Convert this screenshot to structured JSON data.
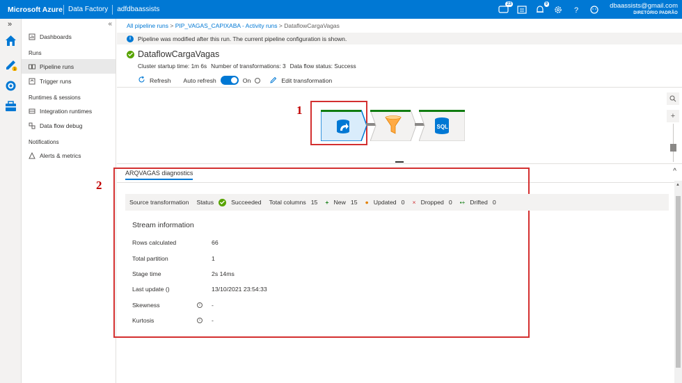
{
  "topbar": {
    "brand": "Microsoft Azure",
    "crumbs": [
      "Data Factory",
      "adfdbaassists"
    ],
    "badge_notifications": "23",
    "badge_bell": "9",
    "user_email": "dbaassists@gmail.com",
    "user_directory": "DIRETÓRIO PADRÃO"
  },
  "rail": {
    "expand": "»",
    "badge": "1"
  },
  "sidebar": {
    "collapse": "«",
    "dashboards": "Dashboards",
    "runs_header": "Runs",
    "pipeline_runs": "Pipeline runs",
    "trigger_runs": "Trigger runs",
    "runtimes_header": "Runtimes & sessions",
    "integration_runtimes": "Integration runtimes",
    "data_flow_debug": "Data flow debug",
    "notifications_header": "Notifications",
    "alerts_metrics": "Alerts & metrics"
  },
  "breadcrumb": {
    "all_runs": "All pipeline runs",
    "sep": ">",
    "activity_runs": "PIP_VAGAS_CAPIXABA - Activity runs",
    "current": "DataflowCargaVagas"
  },
  "info_banner": "Pipeline was modified after this run. The current pipeline configuration is shown.",
  "run": {
    "title": "DataflowCargaVagas",
    "startup_label": "Cluster startup time:",
    "startup_value": "1m 6s",
    "transforms_label": "Number of transformations:",
    "transforms_value": "3",
    "status_label": "Data flow status:",
    "status_value": "Success"
  },
  "toolbar": {
    "refresh": "Refresh",
    "auto_refresh": "Auto refresh",
    "toggle_state": "On",
    "edit": "Edit transformation"
  },
  "annotations": {
    "one": "1",
    "two": "2"
  },
  "nodes": {
    "sink_label": "SQL"
  },
  "zoom": {
    "plus": "+"
  },
  "panel": {
    "tab": "ARQVAGAS diagnostics",
    "collapse": "^",
    "source_transformation": "Source transformation",
    "status_label": "Status",
    "status_value": "Succeeded",
    "total_columns_label": "Total columns",
    "total_columns_value": "15",
    "new_label": "New",
    "new_value": "15",
    "updated_label": "Updated",
    "updated_value": "0",
    "dropped_label": "Dropped",
    "dropped_value": "0",
    "drifted_label": "Drifted",
    "drifted_value": "0"
  },
  "stream": {
    "heading": "Stream information",
    "rows": [
      {
        "label": "Rows calculated",
        "value": "66"
      },
      {
        "label": "Total partition",
        "value": "1"
      },
      {
        "label": "Stage time",
        "value": "2s 14ms"
      },
      {
        "label": "Last update ()",
        "value": "13/10/2021 23:54:33"
      },
      {
        "label": "Skewness",
        "value": "-"
      },
      {
        "label": "Kurtosis",
        "value": "-"
      }
    ]
  },
  "colors": {
    "accent": "#0078d4",
    "success": "#57a300",
    "annotation": "#c00000",
    "node_header": "#107c10"
  }
}
